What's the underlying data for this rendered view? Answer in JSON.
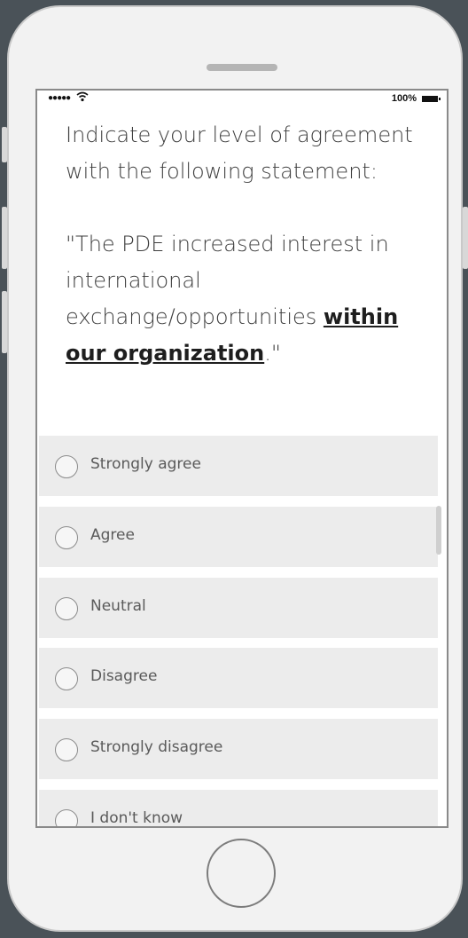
{
  "status_bar": {
    "signal": "●●●●●",
    "wifi_icon": "wifi-icon",
    "battery_percent": "100%"
  },
  "question": {
    "line1": "Indicate your level of agreement with the following statement:",
    "statement_prefix": "\"The PDE increased interest in international exchange/opportunities ",
    "statement_emphasis": "within our organization",
    "statement_suffix": ".\""
  },
  "options": [
    {
      "label": "Strongly agree",
      "selected": false
    },
    {
      "label": "Agree",
      "selected": false
    },
    {
      "label": "Neutral",
      "selected": false
    },
    {
      "label": "Disagree",
      "selected": false
    },
    {
      "label": "Strongly disagree",
      "selected": false
    },
    {
      "label": "I don't know",
      "selected": false
    }
  ]
}
